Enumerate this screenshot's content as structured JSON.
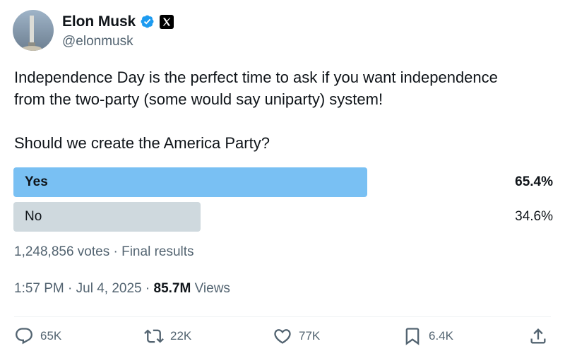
{
  "author": {
    "name": "Elon Musk",
    "handle": "@elonmusk"
  },
  "tweet": {
    "line1": "Independence Day is the perfect time to ask if you want independence",
    "line2": "from the two-party (some would say uniparty) system!",
    "question": "Should we create the America Party?"
  },
  "poll": {
    "options": [
      {
        "label": "Yes",
        "percent": "65.4%",
        "fraction": 0.654,
        "winner": true
      },
      {
        "label": "No",
        "percent": "34.6%",
        "fraction": 0.346,
        "winner": false
      }
    ],
    "meta": "1,248,856 votes · Final results"
  },
  "timestamp": {
    "time": "1:57 PM · Jul 4, 2025 · ",
    "views_count": "85.7M",
    "views_label": " Views"
  },
  "actions": {
    "replies": "65K",
    "reposts": "22K",
    "likes": "77K",
    "bookmarks": "6.4K"
  },
  "colors": {
    "winner_bar": "#79c0f3",
    "loser_bar": "#cfd9de",
    "verified": "#1d9bf0",
    "secondary_text": "#536471"
  },
  "icons": [
    "verified-badge-icon",
    "x-logo-icon",
    "reply-icon",
    "repost-icon",
    "like-icon",
    "bookmark-icon",
    "share-icon"
  ]
}
